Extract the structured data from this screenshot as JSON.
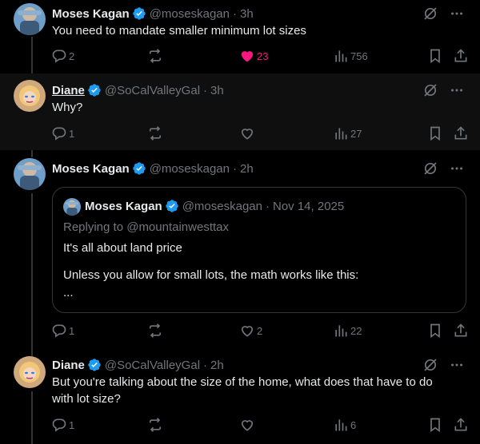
{
  "tweets": [
    {
      "name": "Moses Kagan",
      "handle": "@moseskagan",
      "time": "3h",
      "text": "You need to mandate smaller minimum lot sizes",
      "actions": {
        "replies": "2",
        "reposts": "",
        "likes": "23",
        "views": "756"
      },
      "liked": true
    },
    {
      "name": "Diane",
      "handle": "@SoCalValleyGal",
      "time": "3h",
      "text": "Why?",
      "actions": {
        "replies": "1",
        "reposts": "",
        "likes": "",
        "views": "27"
      },
      "liked": false
    },
    {
      "name": "Moses Kagan",
      "handle": "@moseskagan",
      "time": "2h",
      "text": "",
      "quote": {
        "name": "Moses Kagan",
        "handle": "@moseskagan",
        "time": "Nov 14, 2025",
        "replying_to": "Replying to @mountainwesttax",
        "line1": "It's all about land price",
        "line2": "Unless you allow for small lots, the math works like this:",
        "line3": "..."
      },
      "actions": {
        "replies": "1",
        "reposts": "",
        "likes": "2",
        "views": "22"
      },
      "liked": false
    },
    {
      "name": "Diane",
      "handle": "@SoCalValleyGal",
      "time": "2h",
      "text": "But you're talking about the size of the home, what does that have to do with lot size?",
      "actions": {
        "replies": "1",
        "reposts": "",
        "likes": "",
        "views": "6"
      },
      "liked": false
    }
  ],
  "separator": "·",
  "colors": {
    "accent_like": "#f91880",
    "verified": "#1d9bf0",
    "muted": "#71767b",
    "text": "#e7e9ea"
  },
  "icons": [
    "verified-badge-icon",
    "grok-icon",
    "more-icon",
    "reply-icon",
    "repost-icon",
    "like-icon",
    "views-icon",
    "bookmark-icon",
    "share-icon"
  ]
}
